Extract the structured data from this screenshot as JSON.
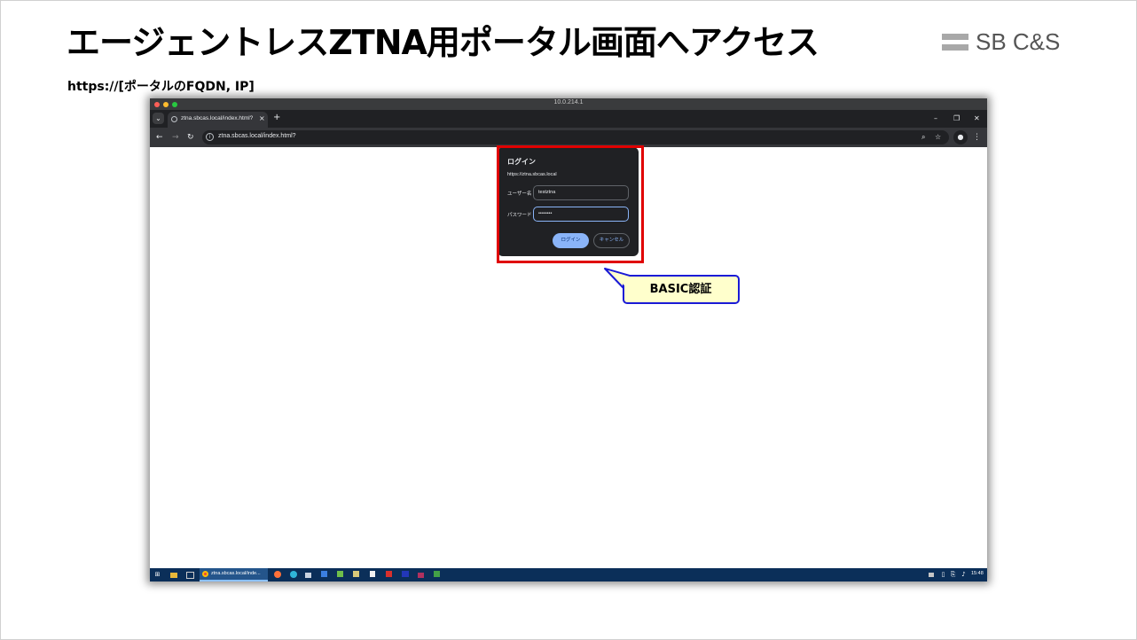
{
  "slide": {
    "title": "エージェントレスZTNA用ポータル画面へアクセス",
    "url_caption": "https://[ポータルのFQDN, IP]",
    "logo_text": "SB C&S"
  },
  "mac_window": {
    "title": "10.0.214.1"
  },
  "browser": {
    "tab_title": "ztna.sbcas.local/index.html?",
    "tab_close": "×",
    "new_tab": "+",
    "window_controls": {
      "minimize": "–",
      "restore": "❐",
      "close": "✕"
    },
    "address": "ztna.sbcas.local/index.html?"
  },
  "login_dialog": {
    "title": "ログイン",
    "origin": "https://ztna.sbcas.local",
    "username_label": "ユーザー名",
    "username_value": "testztna",
    "password_label": "パスワード",
    "password_value": "••••••••",
    "login_button": "ログイン",
    "cancel_button": "キャンセル"
  },
  "annotation": {
    "label": "BASIC認証",
    "highlight_color": "#e00000",
    "callout_border": "#1a1ad6",
    "callout_fill": "#ffffcc"
  },
  "taskbar": {
    "active_app_label": "ztna.sbcas.local/inde...",
    "time": "15:48"
  }
}
